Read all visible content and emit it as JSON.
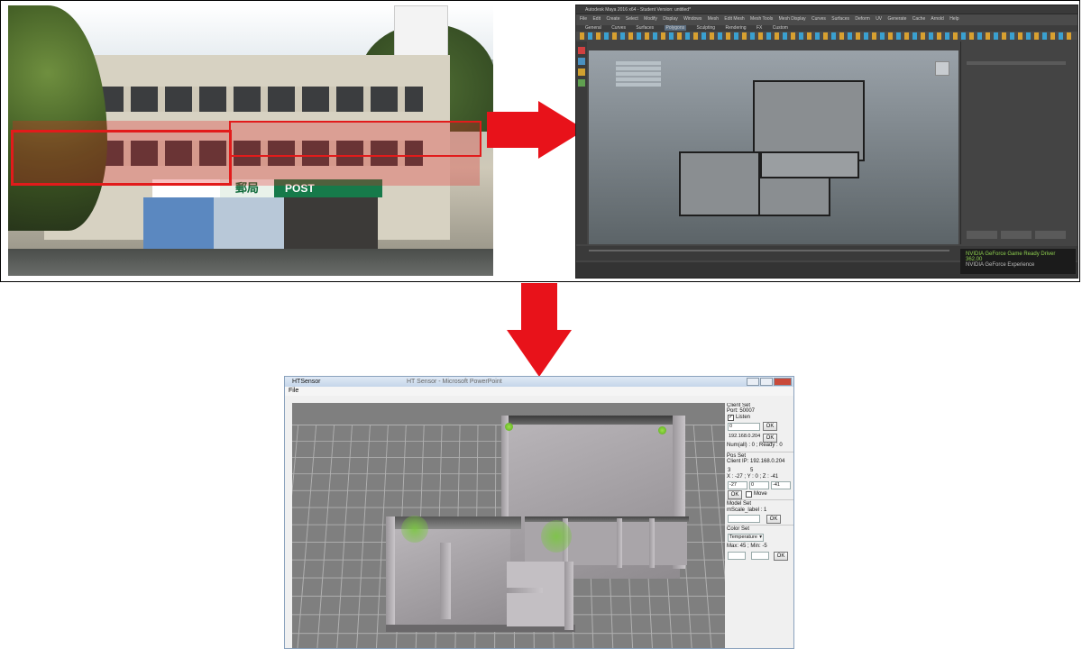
{
  "photo": {
    "sign_post_cn": "郵局",
    "sign_post_en": "POST"
  },
  "maya": {
    "title": "Autodesk Maya 2016 x64 - Student Version: untitled*",
    "menu_items": [
      "File",
      "Edit",
      "Create",
      "Select",
      "Modify",
      "Display",
      "Windows",
      "Mesh",
      "Edit Mesh",
      "Mesh Tools",
      "Mesh Display",
      "Curves",
      "Surfaces",
      "Deform",
      "UV",
      "Generate",
      "Cache",
      "Arnold",
      "Help"
    ],
    "shelf_tabs": [
      "General",
      "Curves",
      "Surfaces",
      "Polygons",
      "Sculpting",
      "Rendering",
      "FX",
      "Custom"
    ],
    "nvidia_line1": "NVIDIA GeForce Game Ready Driver 362.00",
    "nvidia_line2": "NVIDIA GeForce Experience"
  },
  "htsensor": {
    "window_title": "HTSensor",
    "background_title": "HT Sensor - Microsoft PowerPoint",
    "menu_file": "File",
    "client_set": {
      "header": "Client Set",
      "port": "Port: 50007",
      "listen_label": "Listen",
      "listen_checked": true,
      "input1": "0",
      "ok1": "OK",
      "ip_value": "192.168.0.204",
      "ok2": "OK",
      "status": "Num(all) : 0 ; Ready : 0"
    },
    "pos_set": {
      "header": "Pos Set",
      "client_ip": "Client IP: 192.168.0.204",
      "a": "3",
      "b": "5",
      "xyz": "X : -27 ; Y : 0 ; Z : -41",
      "x": "-27",
      "y": "0",
      "z": "-41",
      "ok": "OK",
      "move_label": "Move",
      "move_checked": false
    },
    "model_set": {
      "header": "Model Set",
      "scale_label": "mScale_label : 1",
      "ok": "OK"
    },
    "color_set": {
      "header": "Color Set",
      "mode": "Temperature",
      "range": "Max: 45 ; Min: -5",
      "ok": "OK"
    }
  },
  "colors": {
    "arrow": "#e8121a",
    "highlight_box": "#e21b1b",
    "sensor_green": "#7cc63a"
  }
}
